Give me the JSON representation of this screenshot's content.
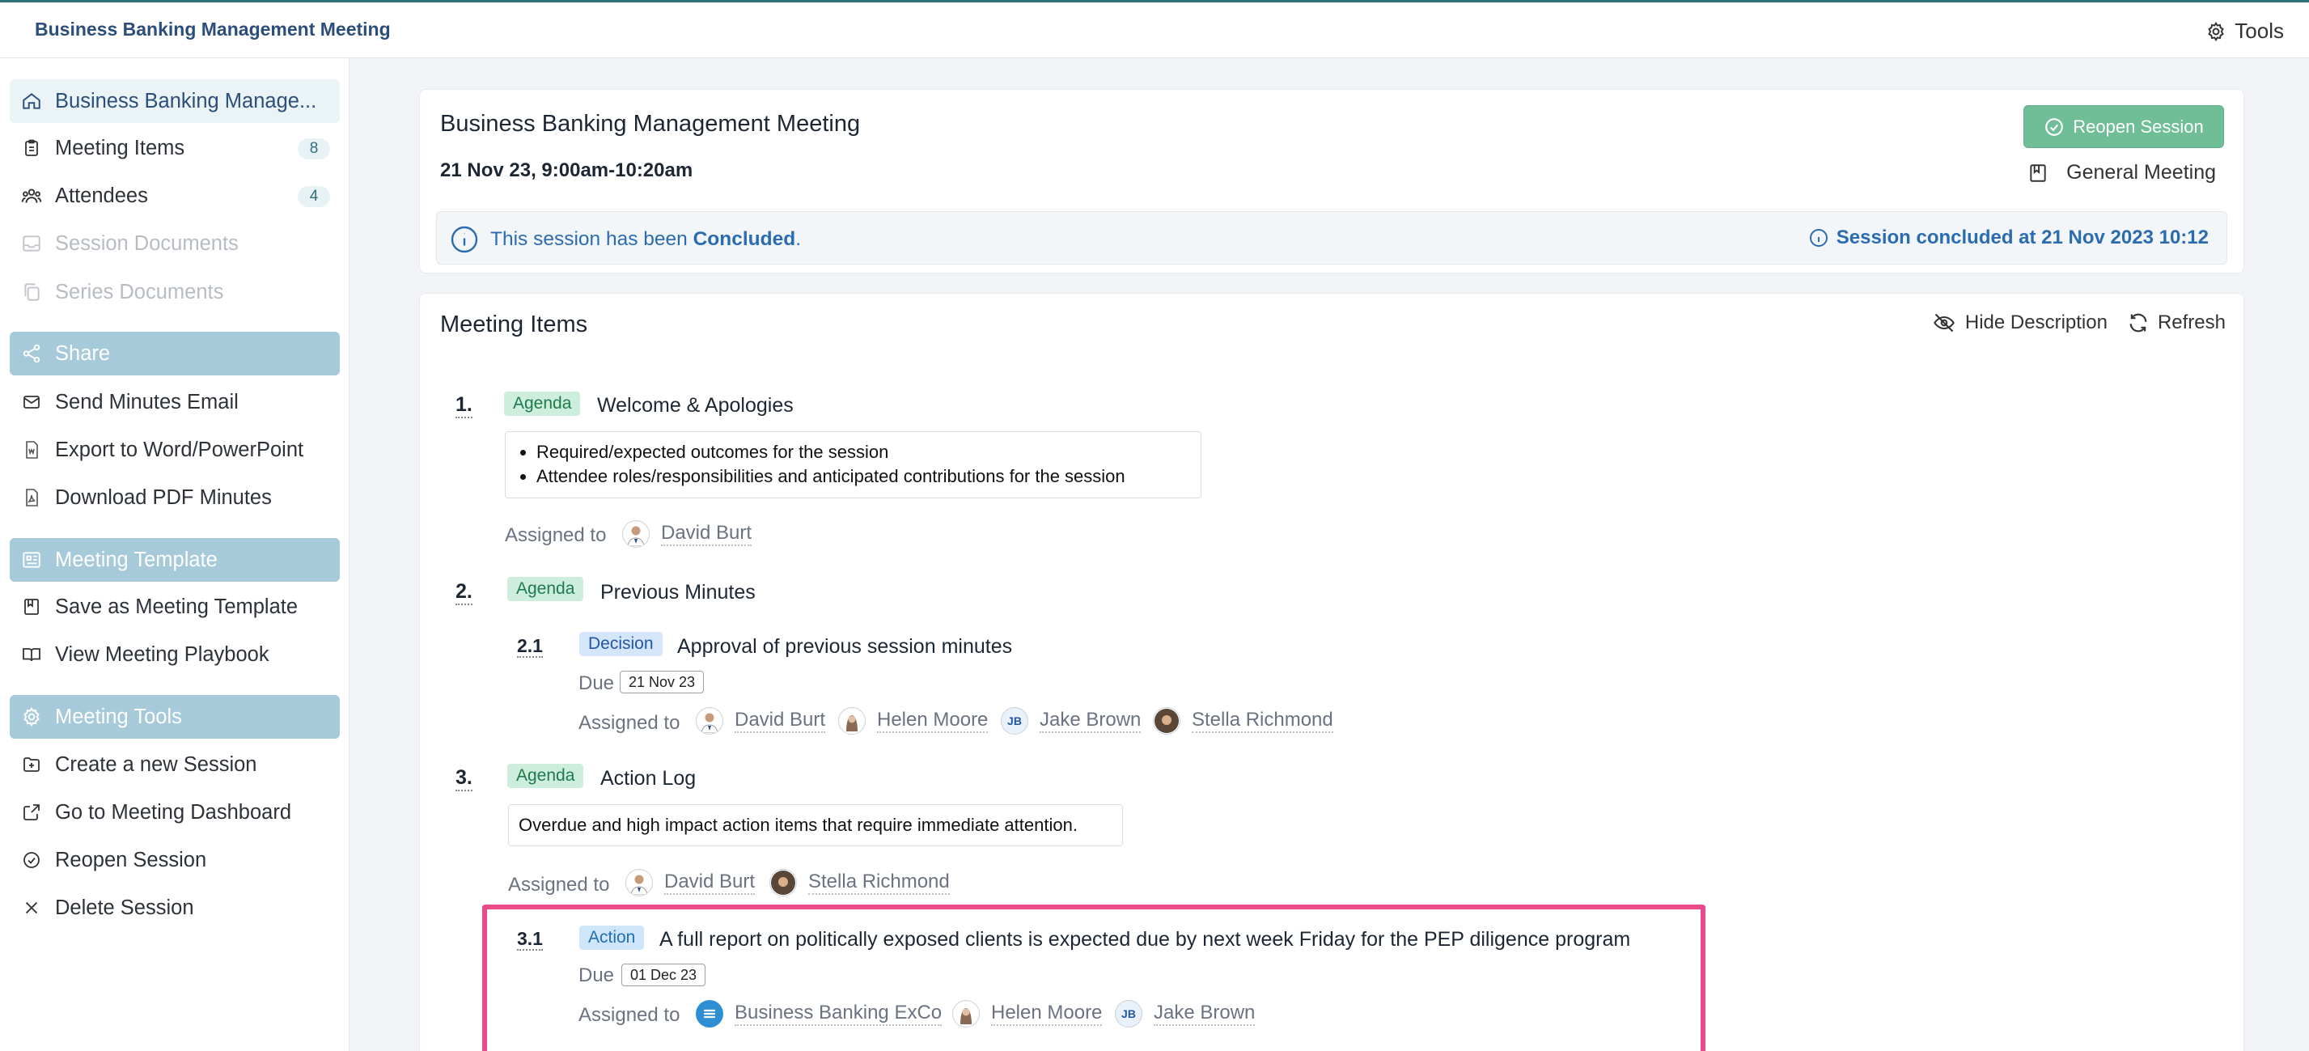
{
  "app": {
    "title": "Business Banking Management Meeting",
    "tools_label": "Tools"
  },
  "sidebar": {
    "items": [
      {
        "label": "Business Banking Manage...",
        "icon": "home-icon"
      },
      {
        "label": "Meeting Items",
        "icon": "clipboard-icon",
        "badge": "8"
      },
      {
        "label": "Attendees",
        "icon": "users-icon",
        "badge": "4"
      },
      {
        "label": "Session Documents",
        "icon": "inbox-icon"
      },
      {
        "label": "Series Documents",
        "icon": "copy-icon"
      }
    ],
    "sections": {
      "share": "Share",
      "template": "Meeting Template",
      "tools": "Meeting Tools"
    },
    "share_items": [
      {
        "label": "Send Minutes Email"
      },
      {
        "label": "Export to Word/PowerPoint"
      },
      {
        "label": "Download PDF Minutes"
      }
    ],
    "template_items": [
      {
        "label": "Save as Meeting Template"
      },
      {
        "label": "View Meeting Playbook"
      }
    ],
    "tool_items": [
      {
        "label": "Create a new Session"
      },
      {
        "label": "Go to Meeting Dashboard"
      },
      {
        "label": "Reopen Session"
      },
      {
        "label": "Delete Session"
      }
    ]
  },
  "session": {
    "title": "Business Banking Management Meeting",
    "date": "21 Nov 23, 9:00am-10:20am",
    "reopen_label": "Reopen Session",
    "meeting_type": "General Meeting",
    "info_prefix": "This session has been ",
    "info_status": "Concluded",
    "info_suffix": ".",
    "concluded_at": "Session concluded at 21 Nov 2023 10:12"
  },
  "meeting_items": {
    "title": "Meeting Items",
    "hide_description": "Hide Description",
    "refresh": "Refresh",
    "assigned_label": "Assigned to",
    "due_label": "Due",
    "items": [
      {
        "num": "1.",
        "tag": "Agenda",
        "text": "Welcome & Apologies",
        "bullets": [
          "Required/expected outcomes for the session",
          "Attendee roles/responsibilities and anticipated contributions for the session"
        ],
        "assignees": [
          "David Burt"
        ]
      },
      {
        "num": "2.",
        "tag": "Agenda",
        "text": "Previous Minutes",
        "sub": {
          "num": "2.1",
          "tag": "Decision",
          "text": "Approval of previous session minutes",
          "due": "21 Nov 23",
          "assignees": [
            "David Burt",
            "Helen Moore",
            "Jake Brown",
            "Stella Richmond"
          ]
        }
      },
      {
        "num": "3.",
        "tag": "Agenda",
        "text": "Action Log",
        "description": "Overdue and high impact action items that require immediate attention.",
        "assignees": [
          "David Burt",
          "Stella Richmond"
        ],
        "sub": {
          "num": "3.1",
          "tag": "Action",
          "text": "A full report on politically exposed clients is expected due by next week Friday for the PEP diligence program",
          "due": "01 Dec 23",
          "assignees": [
            "Business Banking ExCo",
            "Helen Moore",
            "Jake Brown"
          ]
        }
      }
    ],
    "initials_jb": "JB"
  },
  "colors": {
    "accent": "#2b4e7a",
    "section_bg": "#a6cad9",
    "reopen_green": "#6fbe97",
    "highlight": "#ea4a8a"
  }
}
